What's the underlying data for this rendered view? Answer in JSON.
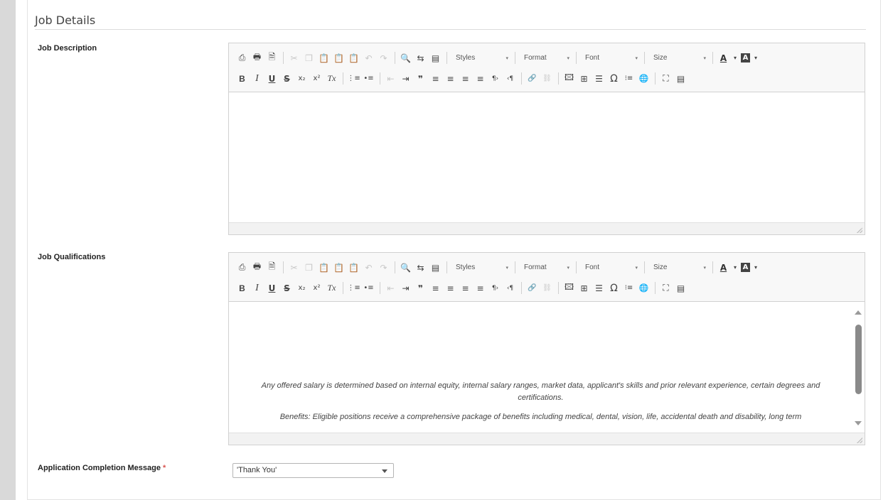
{
  "section": {
    "title": "Job Details"
  },
  "fields": {
    "job_description_label": "Job Description",
    "job_qualifications_label": "Job Qualifications",
    "completion_label": "Application Completion Message",
    "required_marker": "*"
  },
  "toolbar": {
    "combos": {
      "styles": "Styles",
      "format": "Format",
      "font": "Font",
      "size": "Size"
    },
    "glyphs": {
      "preview": "⎙",
      "print": "🖶",
      "templates": "🗎",
      "cut": "✂",
      "copy": "❐",
      "paste": "📋",
      "paste_text": "📋",
      "paste_word": "📋",
      "undo": "↶",
      "redo": "↷",
      "find": "🔍",
      "replace": "⇆",
      "select_all": "▤",
      "bold": "B",
      "italic": "I",
      "underline": "U",
      "strike": "S",
      "subscript": "x₂",
      "superscript": "x²",
      "remove_format": "Tx",
      "numbered_list": "⋮≡",
      "bulleted_list": "•≡",
      "outdent": "⇤",
      "indent": "⇥",
      "blockquote": "❞",
      "align_left": "≡",
      "align_center": "≡",
      "align_right": "≡",
      "justify": "≡",
      "ltr": "¶›",
      "rtl": "‹¶",
      "link": "🔗",
      "unlink": "⛓",
      "image": "🖾",
      "table": "⊞",
      "hr": "☰",
      "special_char": "Ω",
      "list_style": "⁝≡",
      "iframe": "🌐",
      "maximize": "⛶",
      "source": "▤",
      "text_color": "A",
      "bg_color": "A",
      "dropdown": "▾"
    }
  },
  "qualifications_content": {
    "paragraph1": "Any offered salary is determined based on internal equity, internal salary ranges, market data, applicant's skills and prior relevant experience, certain degrees and certifications.",
    "paragraph2": "Benefits: Eligible positions receive a comprehensive package of benefits including medical, dental, vision, life, accidental death and disability, long term"
  },
  "completion_select": {
    "value": "'Thank You'"
  }
}
